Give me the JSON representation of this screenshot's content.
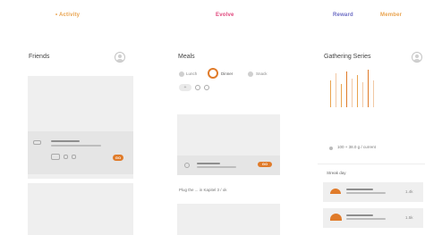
{
  "tabs": [
    {
      "label": "• Activity",
      "color": "#e9a34e"
    },
    {
      "label": "Evolve",
      "color": "#e0457b"
    },
    {
      "label": "Reward",
      "color": "#6b6bc4"
    },
    {
      "label": "Member",
      "color": "#e9a34e"
    }
  ],
  "friends": {
    "title": "Friends",
    "row_button": "GO"
  },
  "meals": {
    "title": "Meals",
    "options": [
      "Lunch",
      "Dinner",
      "Snack"
    ],
    "chip": "+",
    "row_button": "GO",
    "caption": "Plug the ... in Kapitel 3 / ok"
  },
  "reward": {
    "title": "Gathering Series",
    "stat": "100 + 38.0 g / current",
    "section_label": "Streak day",
    "items": [
      {
        "value": "1.4k"
      },
      {
        "value": "1.5k"
      }
    ]
  },
  "colors": {
    "accent": "#e07b2a",
    "card_bg": "#efefef"
  }
}
